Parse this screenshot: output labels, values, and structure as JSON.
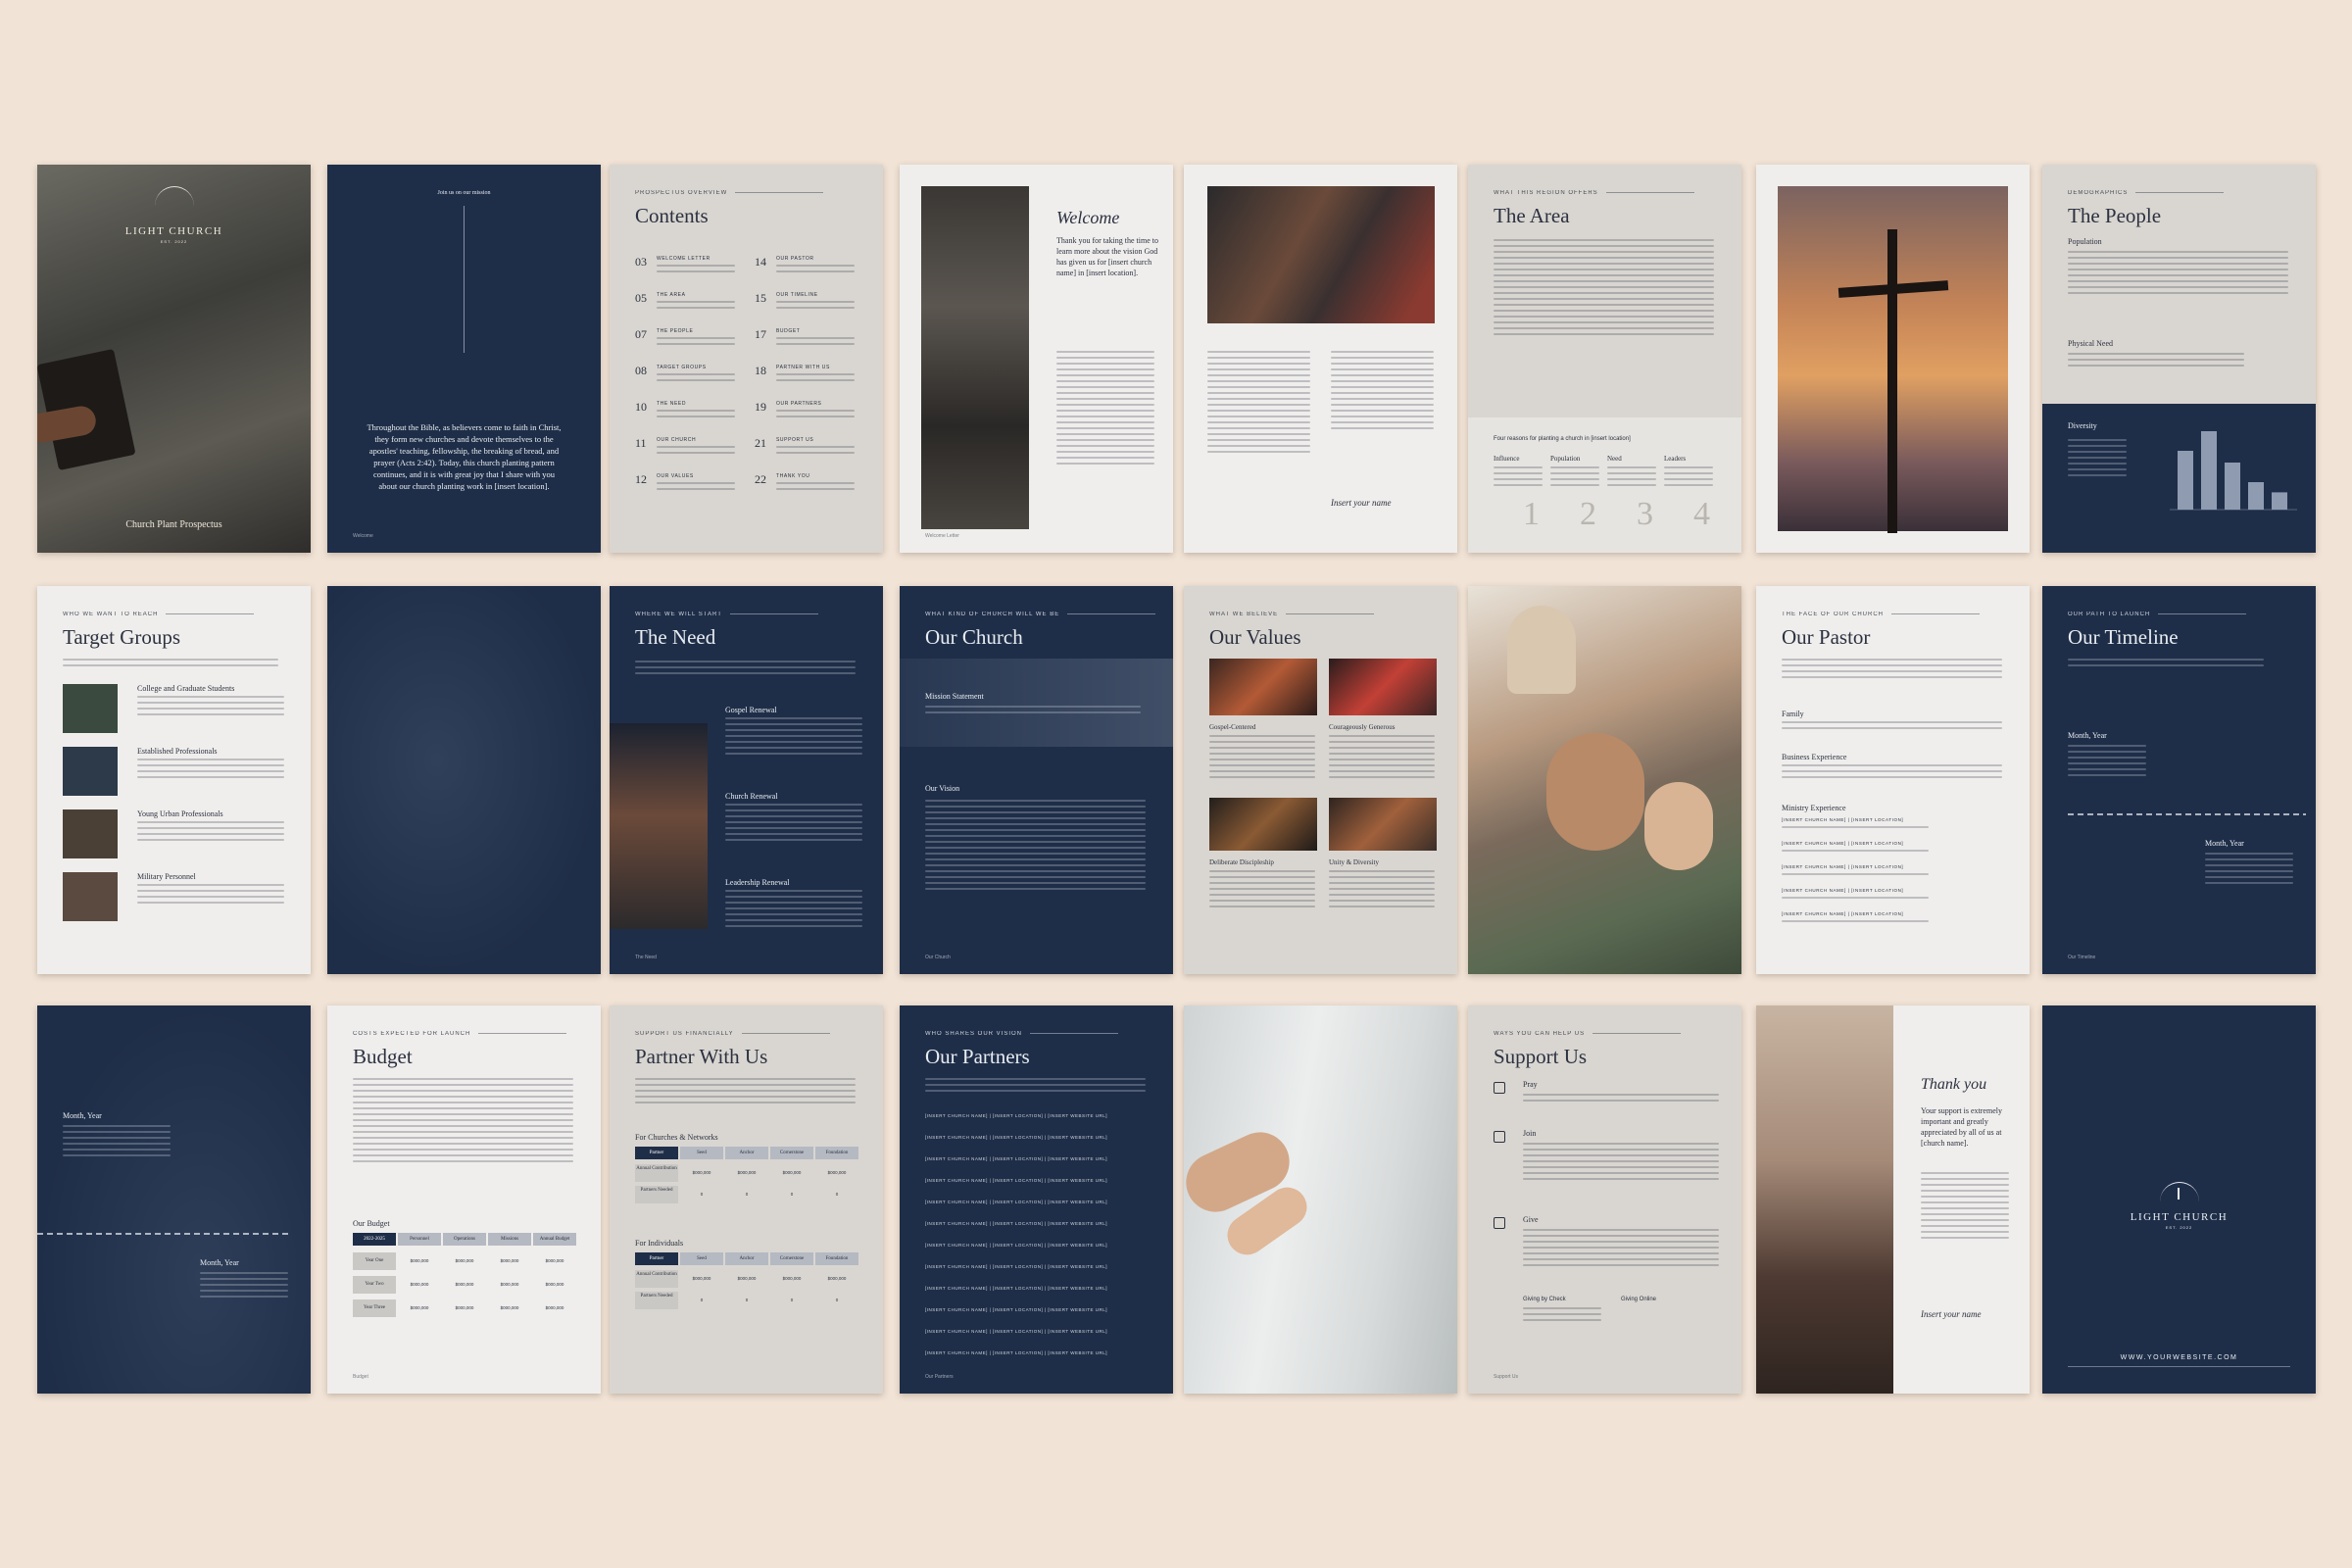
{
  "brand": {
    "name": "LIGHT CHURCH",
    "est": "EST. 2022",
    "cover_subtitle": "Church Plant Prospectus"
  },
  "p2": {
    "kicker": "Join us on our mission",
    "quote": "Throughout the Bible, as believers come to faith in Christ, they form new churches and devote themselves to the apostles' teaching, fellowship, the breaking of bread, and prayer (Acts 2:42). Today, this church planting pattern continues, and it is with great joy that I share with you about our church planting work in [insert location].",
    "footer": "Welcome"
  },
  "contents": {
    "kicker": "PROSPECTUS OVERVIEW",
    "title": "Contents",
    "left": [
      {
        "num": "03",
        "label": "WELCOME LETTER"
      },
      {
        "num": "05",
        "label": "THE AREA"
      },
      {
        "num": "07",
        "label": "THE PEOPLE"
      },
      {
        "num": "08",
        "label": "TARGET GROUPS"
      },
      {
        "num": "10",
        "label": "THE NEED"
      },
      {
        "num": "11",
        "label": "OUR CHURCH"
      },
      {
        "num": "12",
        "label": "OUR VALUES"
      }
    ],
    "right": [
      {
        "num": "14",
        "label": "OUR PASTOR"
      },
      {
        "num": "15",
        "label": "OUR TIMELINE"
      },
      {
        "num": "17",
        "label": "BUDGET"
      },
      {
        "num": "18",
        "label": "PARTNER WITH US"
      },
      {
        "num": "19",
        "label": "OUR PARTNERS"
      },
      {
        "num": "21",
        "label": "SUPPORT US"
      },
      {
        "num": "22",
        "label": "THANK YOU"
      }
    ]
  },
  "welcome": {
    "script": "Welcome",
    "lead": "Thank you for taking the time to learn more about the vision God has given us for [insert church name] in [insert location].",
    "sign": "Insert your name",
    "footer": "Welcome Letter"
  },
  "area": {
    "kicker": "WHAT THIS REGION OFFERS",
    "title": "The Area",
    "reasons": "Four reasons for planting a church in [insert location]",
    "cols": [
      "Influence",
      "Population",
      "Need",
      "Leaders"
    ],
    "numbers": [
      "1",
      "2",
      "3",
      "4"
    ]
  },
  "people": {
    "kicker": "DEMOGRAPHICS",
    "title": "The People",
    "h1": "Population",
    "h2": "Physical Need",
    "h3": "Diversity",
    "chart_data": {
      "type": "bar",
      "categories": [
        "",
        "",
        "",
        "",
        ""
      ],
      "values": [
        75,
        100,
        60,
        35,
        22
      ],
      "title": "",
      "ylim": [
        0,
        100
      ]
    }
  },
  "target": {
    "kicker": "WHO WE WANT TO REACH",
    "title": "Target Groups",
    "groups": [
      "College and Graduate Students",
      "Established Professionals",
      "Young Urban Professionals",
      "Military Personnel"
    ]
  },
  "need": {
    "kicker": "WHERE WE WILL START",
    "title": "The Need",
    "items": [
      "Gospel Renewal",
      "Church Renewal",
      "Leadership Renewal"
    ],
    "footer": "The Need"
  },
  "church": {
    "kicker": "WHAT KIND OF CHURCH WILL WE BE",
    "title": "Our Church",
    "h1": "Mission Statement",
    "h2": "Our Vision",
    "footer": "Our Church"
  },
  "values": {
    "kicker": "WHAT WE BELIEVE",
    "title": "Our Values",
    "items": [
      "Gospel-Centered",
      "Courageously Generous",
      "Deliberate Discipleship",
      "Unity & Diversity"
    ]
  },
  "pastor": {
    "kicker": "THE FACE OF OUR CHURCH",
    "title": "Our Pastor",
    "h1": "Family",
    "h2": "Business Experience",
    "h3": "Ministry Experience",
    "row": "[INSERT CHURCH NAME] | [INSERT LOCATION]"
  },
  "timeline": {
    "kicker": "OUR PATH TO LAUNCH",
    "title": "Our Timeline",
    "m1": "Month, Year",
    "m2": "Month, Year",
    "footer": "Our Timeline"
  },
  "budget": {
    "kicker": "COSTS EXPECTED FOR LAUNCH",
    "title": "Budget",
    "sub": "Our Budget",
    "headers": [
      "2022-2025",
      "Personnel",
      "Operations",
      "Missions",
      "Annual Budget"
    ],
    "rows": [
      {
        "year": "Year One",
        "vals": [
          "$000,000",
          "$000,000",
          "$000,000",
          "$000,000"
        ]
      },
      {
        "year": "Year Two",
        "vals": [
          "$000,000",
          "$000,000",
          "$000,000",
          "$000,000"
        ]
      },
      {
        "year": "Year Three",
        "vals": [
          "$000,000",
          "$000,000",
          "$000,000",
          "$000,000"
        ]
      }
    ],
    "footer": "Budget"
  },
  "partner": {
    "kicker": "SUPPORT US FINANCIALLY",
    "title": "Partner With Us",
    "s1": "For Churches & Networks",
    "s2": "For Individuals",
    "headers": [
      "Partner",
      "Seed",
      "Anchor",
      "Cornerstone",
      "Foundation"
    ],
    "r1": "Annual Contribution",
    "r2": "Partners Needed",
    "amt": "$000,000",
    "cnt": "0"
  },
  "partners": {
    "kicker": "WHO SHARES OUR VISION",
    "title": "Our Partners",
    "row": "[INSERT CHURCH NAME] | [INSERT LOCATION] | [INSERT WEBSITE URL]",
    "footer": "Our Partners"
  },
  "support": {
    "kicker": "WAYS YOU CAN HELP US",
    "title": "Support Us",
    "items": [
      "Pray",
      "Join",
      "Give"
    ],
    "g1": "Giving by Check",
    "g2": "Giving Online",
    "footer": "Support Us"
  },
  "thanks": {
    "script": "Thank you",
    "lead": "Your support is extremely important and greatly appreciated by all of us at [church name].",
    "sign": "Insert your name"
  },
  "back": {
    "url": "WWW.YOURWEBSITE.COM"
  }
}
